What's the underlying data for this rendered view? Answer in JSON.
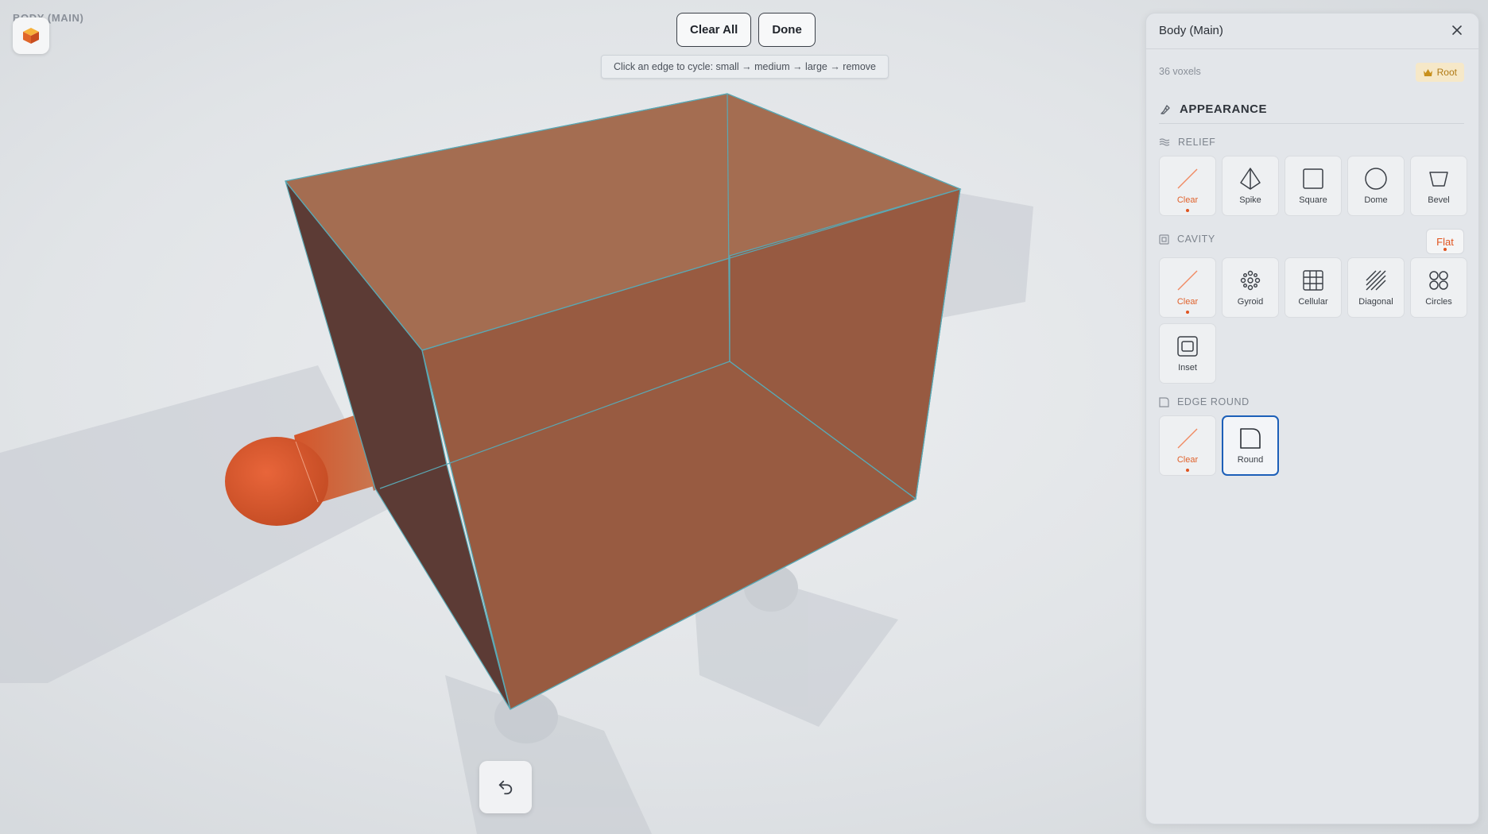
{
  "app": {
    "title": "BODY (MAIN)"
  },
  "toolbar": {
    "clear_all_label": "Clear All",
    "done_label": "Done"
  },
  "hint": {
    "text": "Click an edge to cycle: small → medium → large → remove"
  },
  "panel": {
    "title": "Body (Main)",
    "voxel_count": "36 voxels",
    "root_badge": "Root",
    "appearance_heading": "APPEARANCE",
    "relief": {
      "heading": "RELIEF",
      "options": [
        {
          "label": "Clear",
          "icon": "clear-slash-icon",
          "active": true
        },
        {
          "label": "Spike",
          "icon": "spike-icon"
        },
        {
          "label": "Square",
          "icon": "square-icon"
        },
        {
          "label": "Dome",
          "icon": "dome-icon"
        },
        {
          "label": "Bevel",
          "icon": "bevel-icon"
        }
      ]
    },
    "cavity": {
      "heading": "CAVITY",
      "mode": "Flat",
      "options": [
        {
          "label": "Clear",
          "icon": "clear-slash-icon",
          "active": true
        },
        {
          "label": "Gyroid",
          "icon": "gyroid-icon"
        },
        {
          "label": "Cellular",
          "icon": "cellular-icon"
        },
        {
          "label": "Diagonal",
          "icon": "diagonal-icon"
        },
        {
          "label": "Circles",
          "icon": "circles-icon"
        },
        {
          "label": "Inset",
          "icon": "inset-icon"
        }
      ]
    },
    "edge_round": {
      "heading": "EDGE ROUND",
      "options": [
        {
          "label": "Clear",
          "icon": "clear-slash-icon",
          "active": true
        },
        {
          "label": "Round",
          "icon": "round-corner-icon",
          "selected": true
        }
      ]
    }
  },
  "colors": {
    "accent": "#e0541f",
    "selected_border": "#1c5fb8",
    "box_top": "#a56e52",
    "box_front": "#975b42",
    "box_side": "#5c3b35",
    "knob": "#d9582c"
  }
}
